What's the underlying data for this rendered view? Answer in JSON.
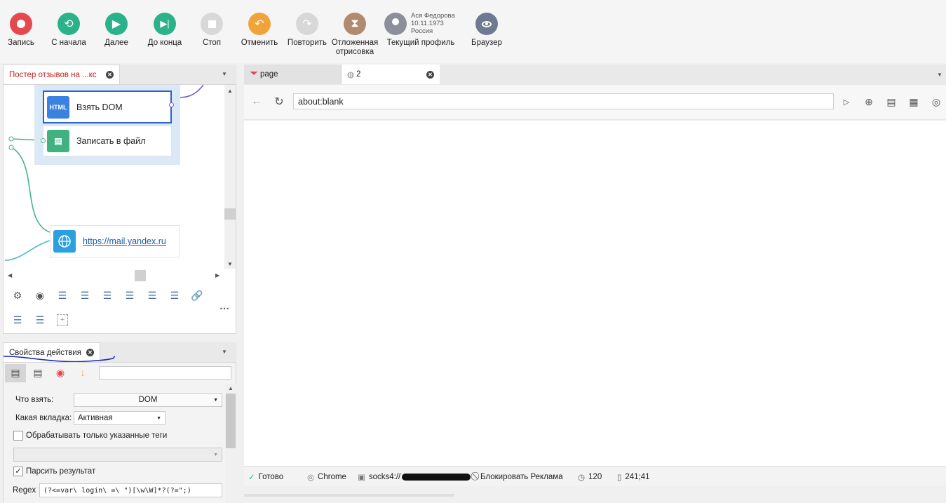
{
  "toolbar": {
    "buttons": [
      {
        "label": "Запись",
        "icon": "record-icon",
        "color": "#e5484d"
      },
      {
        "label": "С начала",
        "icon": "restart-icon",
        "color": "#2bb28a"
      },
      {
        "label": "Далее",
        "icon": "play-icon",
        "color": "#2bb28a"
      },
      {
        "label": "До конца",
        "icon": "skip-end-icon",
        "color": "#2bb28a"
      },
      {
        "label": "Стоп",
        "icon": "stop-icon",
        "color": "#d8d8d8"
      },
      {
        "label": "Отменить",
        "icon": "undo-icon",
        "color": "#f0a33a"
      },
      {
        "label": "Повторить",
        "icon": "redo-icon",
        "color": "#d8d8d8"
      },
      {
        "label": "Отложенная отрисовка",
        "icon": "hourglass-icon",
        "color": "#b08b70"
      },
      {
        "label": "Текущий профиль",
        "icon": "profile-icon",
        "color": "#8a8f99"
      },
      {
        "label": "Браузер",
        "icon": "eye-icon",
        "color": "#6d7a90"
      }
    ],
    "profile": {
      "name": "Ася Федорова",
      "dob": "10.11.1973",
      "country": "Россия"
    }
  },
  "project_panel": {
    "tab_label": "Постер отзывов на ...кс",
    "nodes": [
      {
        "label": "Взять DOM",
        "icon_text": "HTML"
      },
      {
        "label": "Записать в файл"
      },
      {
        "label": "https://mail.yandex.ru"
      }
    ]
  },
  "properties_panel": {
    "tab_label": "Свойства действия",
    "search_placeholder": "",
    "what_take_label": "Что взять:",
    "what_take_value": "DOM",
    "which_tab_label": "Какая вкладка:",
    "which_tab_value": "Активная",
    "only_tags_label": "Обрабатывать только указанные теги",
    "parse_result_label": "Парсить результат",
    "regex_label": "Regex",
    "regex_value": "(?<=var\\ login\\ =\\ \")[\\w\\W]*?(?=\";)"
  },
  "browser": {
    "tabs": [
      {
        "label": "page"
      },
      {
        "label": "2"
      }
    ],
    "url": "about:blank",
    "status": {
      "ready": "Готово",
      "browser": "Chrome",
      "proxy": "socks4://",
      "adblock": "Блокировать Реклама",
      "timeout": "120",
      "coords": "241;41"
    }
  },
  "colors": {
    "accent": "#2a62c9",
    "green": "#2bb28a",
    "red": "#e5484d",
    "orange": "#f0a33a"
  }
}
